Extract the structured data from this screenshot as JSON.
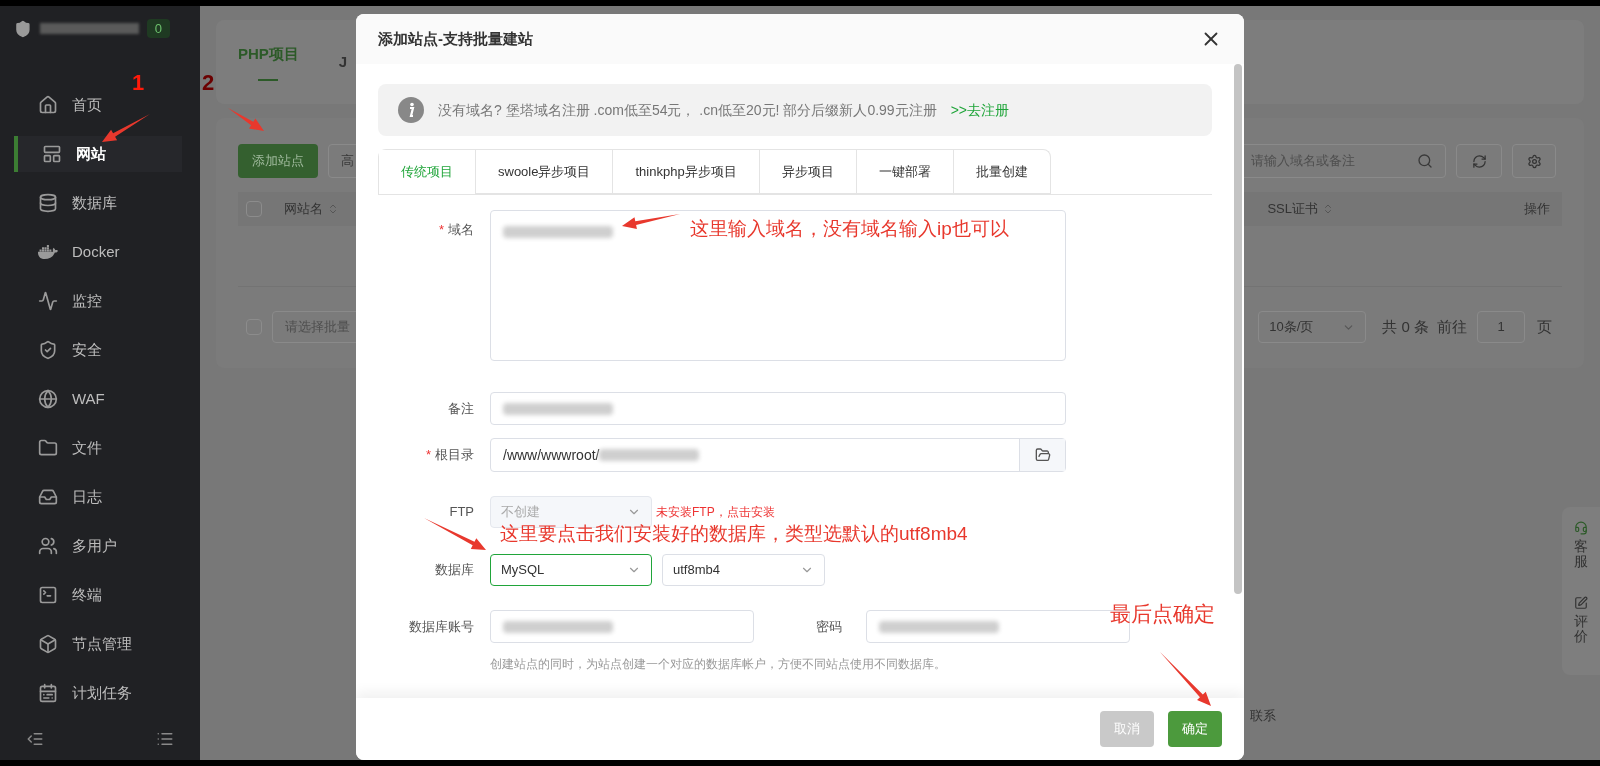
{
  "sidebar": {
    "badge": "0",
    "items": [
      {
        "label": "首页",
        "selected": false
      },
      {
        "label": "网站",
        "selected": true
      },
      {
        "label": "数据库",
        "selected": false
      },
      {
        "label": "Docker",
        "selected": false
      },
      {
        "label": "监控",
        "selected": false
      },
      {
        "label": "安全",
        "selected": false
      },
      {
        "label": "WAF",
        "selected": false
      },
      {
        "label": "文件",
        "selected": false
      },
      {
        "label": "日志",
        "selected": false
      },
      {
        "label": "多用户",
        "selected": false
      },
      {
        "label": "终端",
        "selected": false
      },
      {
        "label": "节点管理",
        "selected": false
      },
      {
        "label": "计划任务",
        "selected": false
      }
    ]
  },
  "page": {
    "tabs": [
      {
        "label": "PHP项目",
        "selected": true
      },
      {
        "label": "J",
        "selected": false
      }
    ],
    "add_button": "添加站点",
    "second_button": "高",
    "search": {
      "placeholder": "请输入域名或备注"
    },
    "columns": [
      "网站名",
      "SSL证书",
      "操作"
    ],
    "header_checkbox": {
      "checked": false
    },
    "batch_checkbox": {
      "checked": false
    },
    "batch_select": {
      "placeholder": "请选择批量"
    },
    "pagination": {
      "page_size": "10条/页",
      "total": "共 0 条",
      "goto": "前往",
      "page": "1",
      "suffix": "页"
    },
    "float_buttons": [
      "客服",
      "评价"
    ],
    "footer_link": "联系"
  },
  "dialog": {
    "title": "添加站点-支持批量建站",
    "notice": {
      "text": "没有域名? 堡塔域名注册 .com低至54元， .cn低至20元! 部分后缀新人0.99元注册",
      "link": ">>去注册"
    },
    "tabs": [
      {
        "label": "传统项目",
        "selected": true
      },
      {
        "label": "swoole异步项目",
        "selected": false
      },
      {
        "label": "thinkphp异步项目",
        "selected": false
      },
      {
        "label": "异步项目",
        "selected": false
      },
      {
        "label": "一键部署",
        "selected": false
      },
      {
        "label": "批量创建",
        "selected": false
      }
    ],
    "domain": {
      "label": "域名",
      "required_mark": "*",
      "redacted": true
    },
    "remark": {
      "label": "备注",
      "redacted": true
    },
    "root": {
      "label": "根目录",
      "required_mark": "*",
      "value": "/www/wwwroot/",
      "redacted": true
    },
    "ftp": {
      "label": "FTP",
      "value": "不创建",
      "disabled": true,
      "note": "未安装FTP，点击安装"
    },
    "database": {
      "label": "数据库",
      "type": "MySQL",
      "focused": true,
      "charset": "utf8mb4"
    },
    "account": {
      "label": "数据库账号",
      "redacted": true
    },
    "password": {
      "label": "密码",
      "redacted": true
    },
    "hint": "创建站点的同时，为站点创建一个对应的数据库帐户，方便不同站点使用不同数据库。",
    "buttons": [
      {
        "label": "取消",
        "kind": "cancel"
      },
      {
        "label": "确定",
        "kind": "confirm"
      }
    ]
  },
  "annotations": [
    {
      "kind": "step",
      "text": "1"
    },
    {
      "kind": "step",
      "text": "2"
    },
    {
      "kind": "callout",
      "text": "这里输入域名，没有域名输入ip也可以"
    },
    {
      "kind": "callout",
      "text": "这里要点击我们安装好的数据库，类型选默认的utf8mb4"
    },
    {
      "kind": "callout",
      "text": "最后点确定"
    }
  ]
}
